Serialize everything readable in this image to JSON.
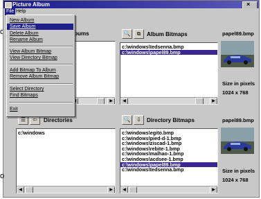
{
  "window": {
    "title": "Picture Album",
    "menu": [
      "File",
      "Help"
    ]
  },
  "file_menu": {
    "items": [
      {
        "label": "New Album",
        "highlighted": false
      },
      {
        "label": "Save Album",
        "highlighted": true
      },
      {
        "label": "Delete Album",
        "highlighted": false
      },
      {
        "label": "Rename Album",
        "highlighted": false
      },
      {
        "label": "View Album Bitmap",
        "highlighted": false
      },
      {
        "label": "View Directory Bitmap",
        "highlighted": false
      },
      {
        "label": "Add Bitmap To Album",
        "highlighted": false
      },
      {
        "label": "Remove Album Bitmap",
        "highlighted": false
      },
      {
        "label": "Select Directory",
        "highlighted": false
      },
      {
        "label": "Find Bitmaps",
        "highlighted": false
      },
      {
        "label": "Exit",
        "highlighted": false
      }
    ]
  },
  "albums": {
    "label": "lbums"
  },
  "album_bitmaps": {
    "label": "Album Bitmaps",
    "items": [
      "c:\\windows\\tedsenna.bmp",
      "c:\\windows\\papel89.bmp"
    ],
    "selected_index": 1,
    "search_icon": "magnifier-icon",
    "glasses_icon": "glasses-icon"
  },
  "album_preview": {
    "filename": "papel89.bmp",
    "size_label": "Size in pixels",
    "size_value": "1024 x 768"
  },
  "directories": {
    "label": "Directories",
    "items": [
      "c:\\windows"
    ]
  },
  "directory_bitmaps": {
    "label": "Directory Bitmaps",
    "items": [
      "c:\\windows\\egito.bmp",
      "c:\\windows\\pied-d-1.bmp",
      "c:\\windows\\ziscad-1.bmp",
      "c:\\windows\\rebite-1.bmp",
      "c:\\windows\\malhao-1.bmp",
      "c:\\windows\\acdsee-1.bmp",
      "c:\\windows\\papel89.bmp",
      "c:\\windows\\tedsenna.bmp"
    ],
    "selected_index": 6
  },
  "directory_preview": {
    "filename": "papel89.bmp",
    "size_label": "Size in pixels",
    "size_value": "1024 x 768"
  },
  "edge_letters": [
    "o",
    "o"
  ],
  "colors": {
    "selection": "#3a2890",
    "menu_highlight": "#20208a",
    "window_face": "#c8c8c8",
    "titlebar": "#1a1a8c"
  }
}
